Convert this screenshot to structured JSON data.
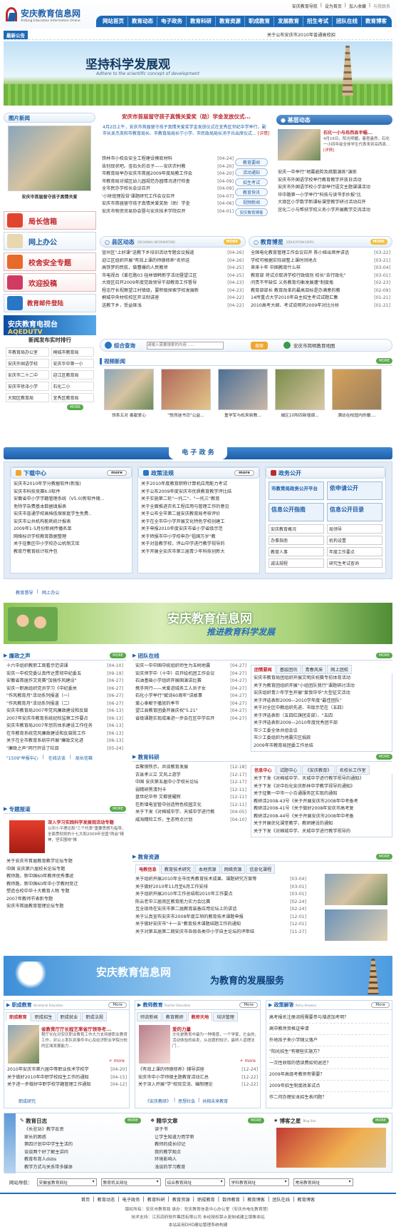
{
  "site": {
    "logo": "安庆教育信息网",
    "logo_en": "AnQing Education Information Online"
  },
  "toplinks": [
    "安庆教育导航",
    "设为首页",
    "加入收藏"
  ],
  "toplink_fav": "与我联系",
  "nav": [
    "网站首页",
    "教育动态",
    "电子政务",
    "教育科研",
    "教育资源",
    "职成教育",
    "发展教育",
    "招生考试",
    "团队在线",
    "教育博客"
  ],
  "ticker": {
    "label": "最新公告",
    "text": "关于公布安庆市2010年普通高校招"
  },
  "banner": {
    "title": "坚持科学发展观",
    "sub": "Adhere to the scientific concept of development"
  },
  "photonews": {
    "title": "图片新闻",
    "caption": "安庆市首届留守孩子真情关爱"
  },
  "headline": {
    "title": "安庆市首届留守孩子真情关爱奖（助）学金发放仪式...",
    "summary": "4月2日上午，安庆市首届留守孩子真情关爱奖学金发放仪式在宜秀区世纪中学举行，副市长吴杰英和市教育局长、市教育局局长宁小学、市民政局局长汤子兵出席仪式...",
    "more": "[详情]"
  },
  "topnews": [
    {
      "t": "铁林市小校会安全工程建设摸底材料",
      "d": "[04-24]"
    },
    {
      "t": "告别现状吧。金石头的日子——安庆农村教",
      "d": "[04-20]"
    },
    {
      "t": "市教育局举办安庆市首届2009年度局教工作会",
      "d": "[04-20]"
    },
    {
      "t": "市教育局对城区幼儿园规范办园情况进行检查",
      "d": "[04-09]"
    },
    {
      "t": "全市民办学校长会议召开",
      "d": "[04-09]"
    },
    {
      "t": "'小财班理投背'课题研究工作会议召开",
      "d": "[04-07]"
    },
    {
      "t": "安庆市首届留守孩子真情关爱奖助（助）学金",
      "d": "[04-06]"
    },
    {
      "t": "安庆市物资贸易协会暨与安庆技术学院召开",
      "d": "[04-01]"
    }
  ],
  "sidebtns": [
    "教育要闻",
    "活动通知",
    "招生考试",
    "教育快讯",
    "视频新闻",
    "安庆教育博客"
  ],
  "jiceng": {
    "title": "基层动态",
    "head": "石化一小与岳西县半幅...",
    "summary": "4月16日，阳光明媚，春意盎然，石化一小四年级全体学生代表来到岳西县...",
    "more": "[详情]",
    "items": [
      "安庆一中举行\"地震避险及疏散演练\"演练",
      "安庆市外国语学校举行教育教学开放日活动",
      "安庆市外国语学校小学部举行语文主题课课活动",
      "华中路第一小学举行\"科技与读书手抄报\"比",
      "大观区小学数学新课标课堂教学研讨活动召开",
      "宜化二小与帮扶学校义务小学开展教学交流活动"
    ]
  },
  "left_btns": [
    "局长信箱",
    "网上办公",
    "校舍安全专题",
    "欢迎投稿",
    "教育邮件登陆"
  ],
  "tv": {
    "title": "安庆教育电视台",
    "sub": "AQEDUTV"
  },
  "ranking": {
    "title": "新闻发布实时排行",
    "items": [
      "市教育局办公室",
      "桐城市教育局",
      "安庆外国语学校",
      "安庆华中第一小",
      "安庆市二十二中",
      "迎江区教育局",
      "安庆市徐泽小学",
      "石化二小",
      "大观区教育局",
      "宜秀区教育局"
    ]
  },
  "county": {
    "title": "县区动态",
    "en": "[REGIONAL INFORMATION]",
    "items": [
      {
        "t": "宣州区\"上好课\"送教下乡培训活动专题会议报道",
        "d": "[04-26]"
      },
      {
        "t": "迎江区组织开展\"有效上课的师德修养\"名师送",
        "d": "[04-26]"
      },
      {
        "t": "高铁梦的民航，做曹爆的人民教师",
        "d": "[04-25]"
      },
      {
        "t": "市电视台《爱在路03 桂林镇韩新学活动暨望江区",
        "d": "[04-25]"
      },
      {
        "t": "大观区召开2009年度党政领导干部教育工作督导",
        "d": "[04-23]"
      },
      {
        "t": "程忠厅长视察望江村镇级，要积极探索学校发展新",
        "d": "[04-23]"
      },
      {
        "t": "桐城中央材校校区开法制讲座",
        "d": "[04-22]"
      },
      {
        "t": "送教下乡，受益匪浅",
        "d": "[04-22]"
      }
    ]
  },
  "expo": {
    "title": "教育博览",
    "en": "[EDUCATION EXPO]",
    "items": [
      {
        "t": "全国电化教育管理工作会议召开 陈小娅出席并讲话",
        "d": "[03-22]"
      },
      {
        "t": "学校可根据实际调整上课时间地点",
        "d": "[03-21]"
      },
      {
        "t": "来来十年 中国教育什么样",
        "d": "[03-04]"
      },
      {
        "t": "教育部 将试点取消学校行政级别 校长\"去行政化\"",
        "d": "[03-01]"
      },
      {
        "t": "问责不平缺位 义务教育均衡发展遭\"制度瓶",
        "d": "[02-23]"
      },
      {
        "t": "教育部部长 教育改革的最高目标是办满意的教",
        "d": "[02-09]"
      },
      {
        "t": "14所重点大学2010年自主招生考试试题汇集",
        "d": "[01-21]"
      },
      {
        "t": "2010高考大纲、考试说明将2009年对比分析",
        "d": "[01-21]"
      }
    ]
  },
  "search": {
    "title": "综合查询",
    "placeholder": "请输入需要搜索的内容……",
    "button": "搜索",
    "map": "安庆市简明教育地图"
  },
  "video": {
    "title": "视频新闻",
    "items": [
      "领系五对 奏献爱心",
      "\"悦然迷书日\"公益...",
      "重学军与松来新教...",
      "城区10所四新增调...",
      "满幼在校园内的暖...."
    ]
  },
  "egov": {
    "title": "电 子 政 务"
  },
  "download": {
    "title": "下载中心",
    "items": [
      "安庆市2010年学分教据软件(新版)",
      "安庆市科技竞赛6.0软件",
      "安徽省中小学学籍管理系统（V5.0)新软件随...",
      "免除学杂费基本数据填报表",
      "安庆市普通学校高档低保家庭学生免费..",
      "安庆市公共机构能耗统计报表",
      "2009年1-5月份新闻传播名单",
      "网络标识学校教育数据整理",
      "关于征集区中小学校办公机制文库",
      "教育厅教育统计软件包"
    ]
  },
  "policy": {
    "title": "政策法规",
    "items": [
      "关于2010年度教育职称计算机应用能力考试",
      "关于公布2009年度安庆市优质教育教学评比结",
      "关于实施第二轮\"一托二\"、\"一托三\"教育",
      "关于全面推进农名工程应用与管理工作的意见",
      "关于公布全市第二届安庆教育局考核评价",
      "关于在全市中小学开展文化特色学校创建工",
      "关于申报2010年度安庆市省小学省级示范",
      "关于转报市中小学校申办\"祖国万岁\"教",
      "关于对普教学校，评山中学进行教学视导的",
      "关于开展全安庆市第三届青少年科技创新大"
    ]
  },
  "gov_open": {
    "title": "政务公开",
    "cards": [
      "市教育局政务公开平台",
      "依申请公开",
      "信息公开指南",
      "信息公开目录"
    ],
    "items": [
      "安庆教育概况",
      "局领导",
      "办事指南",
      "机构设置",
      "教育人事",
      "年度工作要点",
      "减法规程",
      "研究生考试查询"
    ]
  },
  "inline_links": [
    "教育督导",
    "网上办公"
  ],
  "banner2": {
    "title": "安庆教育信息网",
    "sub": "推进教育科学发展"
  },
  "party": {
    "title": "廉政之声",
    "items": [
      {
        "t": "十六中组织教职工观看示范讲课",
        "d": "[04-10]"
      },
      {
        "t": "安庆一中校党委认真传达贯彻中纪委五",
        "d": "[09-19]"
      },
      {
        "t": "安徽省首届作文竞赛\"加强作风建设\"",
        "d": "[06-27]"
      },
      {
        "t": "安庆一职高组织党员学习《中纪委关",
        "d": "[06-27]"
      },
      {
        "t": "\"作风教育月\"活动系列报道（一）",
        "d": "[06-27]"
      },
      {
        "t": "\"作风教育月\"活动系列报道（二）",
        "d": "[06-27]"
      },
      {
        "t": "安庆市教育局2007年党风廉政建设和反腐",
        "d": "[06-13]"
      },
      {
        "t": "2007年安庆市教育系统纪检监察工作要点",
        "d": "[06-13]"
      },
      {
        "t": "安庆市教育局2007年惩防体系建设工作任务",
        "d": "[06-13]"
      },
      {
        "t": "在市教育系统党风廉政建设和反腐败工作",
        "d": "[06-13]"
      },
      {
        "t": "关于在全市教育系统中开展\"廉政文化进",
        "d": "[06-13]"
      },
      {
        "t": "\"廉政之声\"同行开设了栏目",
        "d": "[05-24]"
      }
    ],
    "links": [
      "\"1509\"举报中心",
      "在线访谈",
      "局长信箱"
    ]
  },
  "team": {
    "title": "团队在线",
    "items": [
      {
        "t": "安庆一中中国中统组织师生为玉树地震",
        "d": "[04-27]"
      },
      {
        "t": "安庆师学中（十中）召开绘机团工作会议",
        "d": "[04-27]"
      },
      {
        "t": "石油基础小学组织开展国演讲比赛",
        "d": "[04-27]"
      },
      {
        "t": "携手同行——关爱进城务工人员子女",
        "d": "[04-27]"
      },
      {
        "t": "石化小学举行\"赋诗60周年\"讲故事",
        "d": "[04-27]"
      },
      {
        "t": "爱心奉献于播放的季节",
        "d": "[04-27]"
      },
      {
        "t": "望江县教育团委开展庆祝\"5.21\"",
        "d": "[04-27]"
      },
      {
        "t": "省级课题实现成果进一步会在区中学召开",
        "d": "[04-27]"
      }
    ],
    "tabs": [
      "团情要闻",
      "基层团讯",
      "青春风采",
      "网上团校"
    ],
    "right": [
      "安庆市教育局团组织开展文明庆祝赛专前体育活动",
      "关于为教育团组织开展\"小组团队我行\"课题研讨活动",
      "安庆组织青少年学生开展\"爱我中华\"大型征文活动",
      "关于评选表彰2009—2010学年度\"最佳团队\"",
      "关于对全区中教组织先进、市级示范在（五四）",
      "关于评选表彰（五四红旗团支部）、\"五四",
      "关于评选表彰2009—2010年度优秀团干部",
      "市少工委全体共组会议",
      "市少工委组织为地震灾区捐款",
      "2009年市教育局团委工作总结"
    ]
  },
  "special": {
    "title": "专题报道",
    "head": "深入学习实践科学发展观活动专题",
    "summary": "以邓小平理论和\"三个代表\"重要思想为指导，全面贯彻党的十七大和2009年全国\"两会\"精神，坚实围绕\"推",
    "items": [
      "关于安庆市首届教育教学论坛专题",
      "中国 安庆第六届校长论坛专题",
      "教师路，新中国60年教师优秀事迹",
      "教师路，新中国60年中小学教材变迁",
      "塑造仓校中华十大教育人物 专题",
      "2007年教师节表彰专题",
      "安庆市首届教育管理论坛专题"
    ]
  },
  "research": {
    "title": "教育科研",
    "items": [
      {
        "t": "会聚钢铁示，共谈教育发展",
        "d": "[12-18]"
      },
      {
        "t": "古县孝义立 文风上游学",
        "d": "[12-17]"
      },
      {
        "t": "中国 安庆第五届中小学校长论坛",
        "d": "[12-17]"
      },
      {
        "t": "弱精研黑清列卡",
        "d": "[12-11]"
      },
      {
        "t": "盘世纪华帝 文都营耀辉",
        "d": "[12-11]"
      },
      {
        "t": "在新增电宣管中创造特色校园文化",
        "d": "[12-11]"
      },
      {
        "t": "关于下发《对棉城中学、天城中学进行教",
        "d": "[04-05]"
      },
      {
        "t": "威海精检工作，生态特点计划",
        "d": "[04-10]"
      }
    ],
    "tabs": [
      "信息中心",
      "试题中心",
      "《安庆教育》",
      "名校长工作室"
    ],
    "right": [
      "关于下发《对棉城中学、天城中学进行教学视导的通知》",
      "关于下发《对中石化安庆新林中学教学视导的通知》",
      "关于征集一中市一小合通服务区实现的通知",
      "教研活2008-43号《关于开展安庆市2008年中考备考",
      "教研活2008-41号《关于做好2008年安庆市高考复",
      "教研活2008-44号《关于开展安庆市2008年中考备",
      "关于开展优化课堂教学，教研建设的通知",
      "关于下发《对棉城中学、天城中学进行教学视导的"
    ]
  },
  "resource": {
    "title": "教育资源",
    "tabs": [
      "电教信息",
      "教育技术研究",
      "本地资源",
      "网络资源",
      "信息化课程"
    ],
    "items": [
      {
        "t": "关于组织开展2010年全市优秀教育技术成果、课题研究方案等",
        "d": "[03-04]"
      },
      {
        "t": "关于做好2010年11月至6月工作安排",
        "d": "[03-01]"
      },
      {
        "t": "关于组织开展2010年工作总结和2010年工作要点",
        "d": "[03-01]"
      },
      {
        "t": "陈云老中三届南区教育能力实力会比赛",
        "d": "[02-24]"
      },
      {
        "t": "互全现场在安庆市第二届教育装备应用论坛上的讲话",
        "d": "[02-24]"
      },
      {
        "t": "关于认真宣布安庆市2008年度立项的教育技术课题申报",
        "d": "[12-01]"
      },
      {
        "t": "关于做好安庆市\"十一五\"教育技术课题结题工作的通知",
        "d": "[12-01]"
      },
      {
        "t": "关于对第五届第二期安庆市各级各类中小学自主论坛的评审结",
        "d": "[11-27]"
      }
    ]
  },
  "banner3": {
    "title": "安庆教育信息网",
    "sub": "为教育的发展服务"
  },
  "vocational": {
    "title": "职成教育",
    "en": "Vocational Education",
    "tabs": [
      "职成教育",
      "职成招生",
      "职成就业",
      "职成法规"
    ],
    "head": "省教育厅厅长程艺率省厅领导考...",
    "summary": "程厅长在对安庆职业教育工作大力支持是职业教育工作，对以上率队到事件中心及经济职业学院分校的区域发展能力...",
    "more": "+ more",
    "items": [
      {
        "t": "2010年安庆市第六届中等职业技术学校学",
        "d": "[04-20]"
      },
      {
        "t": "关于做好2010年中职学校招生工作的通知",
        "d": "[04-15]"
      },
      {
        "t": "关于进一步做好中职学校学籍管理工作通知",
        "d": "[04-12]"
      }
    ],
    "links": [
      "职成研究"
    ]
  },
  "teacher": {
    "title": "教师教育",
    "en": "Teacher Education",
    "tabs": [
      "师流新闻",
      "教育教研",
      "教师天地",
      "培训管理"
    ],
    "head": "爱的力量",
    "summary": "文化是教育中最为一种情感，一个学家，它会的，活动体验的启发，从这题的知识，最终人道理法门...",
    "more": "+ more",
    "items": [
      {
        "t": "《有效上课的师德修养》辅导讲座",
        "d": "[12-24]"
      },
      {
        "t": "安庆市中小学师德主题教育活动汇总",
        "d": "[12-22]"
      },
      {
        "t": "关于深入开展\"学\"校际交流、编制理论",
        "d": "[12-22]"
      }
    ],
    "links": [
      "《安庆教研》",
      "思想社会",
      "共相未来教育"
    ]
  },
  "faq": {
    "title": "政策解答",
    "en": "Policy Answers",
    "items": [
      "高考报名注册流程需要参与增进加考明？",
      "高中教师资格证申请",
      "外地孩子来小学随父落户",
      "\"阳光招生\"有哪些实施方？",
      "一次性收取的借读费如何退还？",
      "2009年高级考教师有需要？",
      "2009年招生制度改革试点",
      "作二何办理安本招生表问题？"
    ]
  },
  "diary": {
    "title": "教育日志",
    "items": [
      "《长驻站》教学反思",
      "家长的困惑",
      "第四计划中中学生生活的",
      "谈谈两个好了解主讲问",
      "教育布育人dsbs",
      "教学方式与关系带多媒体"
    ]
  },
  "essay": {
    "title": "精华文章",
    "items": [
      "读于书",
      "让学生知道力而学新",
      "教师的成长印记",
      "我的教学观点",
      "环境影响人",
      "浅谈的学习教育"
    ]
  },
  "star": {
    "title": "博客之星",
    "sub": "Blog Star"
  },
  "selectrow": {
    "label": "网站导航：",
    "opts": [
      "安徽省教育网址",
      "教育机关网址",
      "综合教育网址",
      "学科教育网址",
      "常用教育网址"
    ]
  },
  "footer": {
    "links": [
      "首页",
      "教育动态",
      "电子政务",
      "教育科研",
      "教育资源",
      "职成教育",
      "数师教育",
      "教育博客",
      "团队在线",
      "教育博客"
    ],
    "l1": "版权所有：安庆市教育局 承办：安庆教育信息中心办公室（安庆市电化教育馆）",
    "l2": "技术支持：江苏润府软件集团有限公司 未经授权禁止复制或建立镜像本站",
    "l3": "本站采用DHD建站管理系统构建"
  }
}
